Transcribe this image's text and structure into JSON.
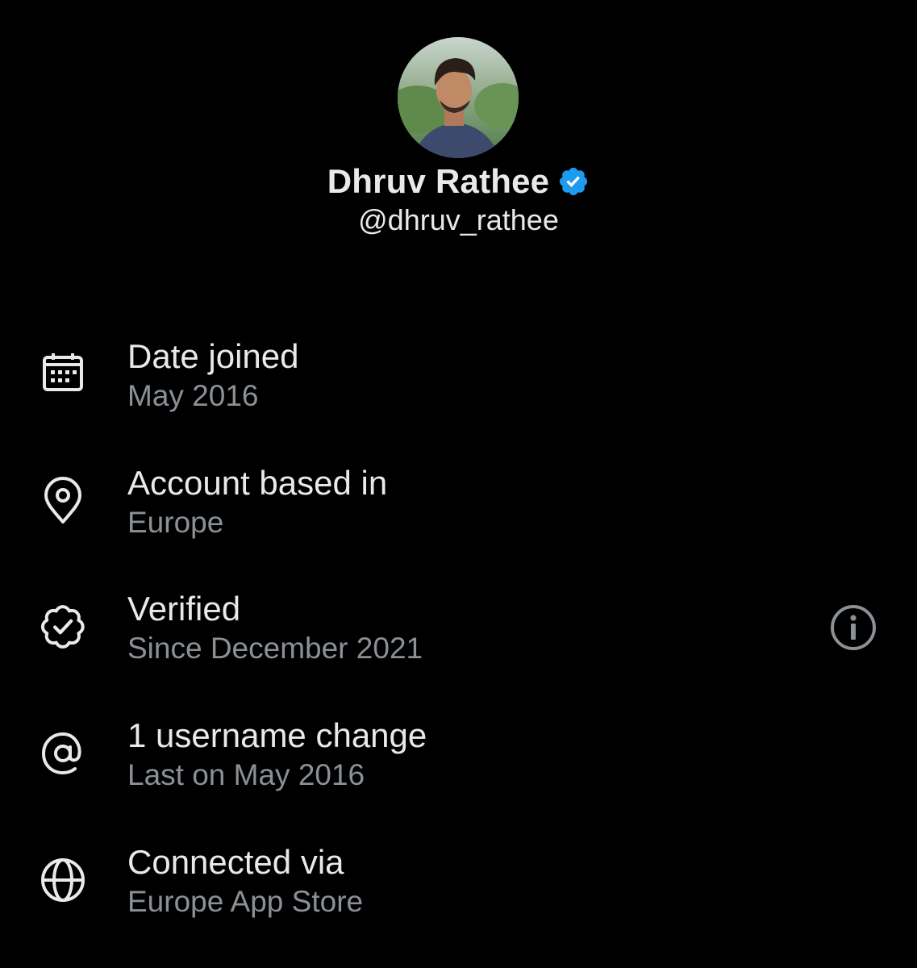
{
  "profile": {
    "display_name": "Dhruv Rathee",
    "handle": "@dhruv_rathee",
    "verified": true,
    "badge_color": "#1d9bf0"
  },
  "theme": {
    "background": "#000000",
    "primary_text": "#e7e9ea",
    "secondary_text": "#8b9096"
  },
  "rows": [
    {
      "icon": "calendar-icon",
      "title": "Date joined",
      "subtitle": "May 2016"
    },
    {
      "icon": "location-pin-icon",
      "title": "Account based in",
      "subtitle": "Europe"
    },
    {
      "icon": "verified-badge-icon",
      "title": "Verified",
      "subtitle": "Since December 2021",
      "action_icon": "info-icon"
    },
    {
      "icon": "at-sign-icon",
      "title": "1 username change",
      "subtitle": "Last on May 2016"
    },
    {
      "icon": "globe-icon",
      "title": "Connected via",
      "subtitle": "Europe App Store"
    }
  ]
}
